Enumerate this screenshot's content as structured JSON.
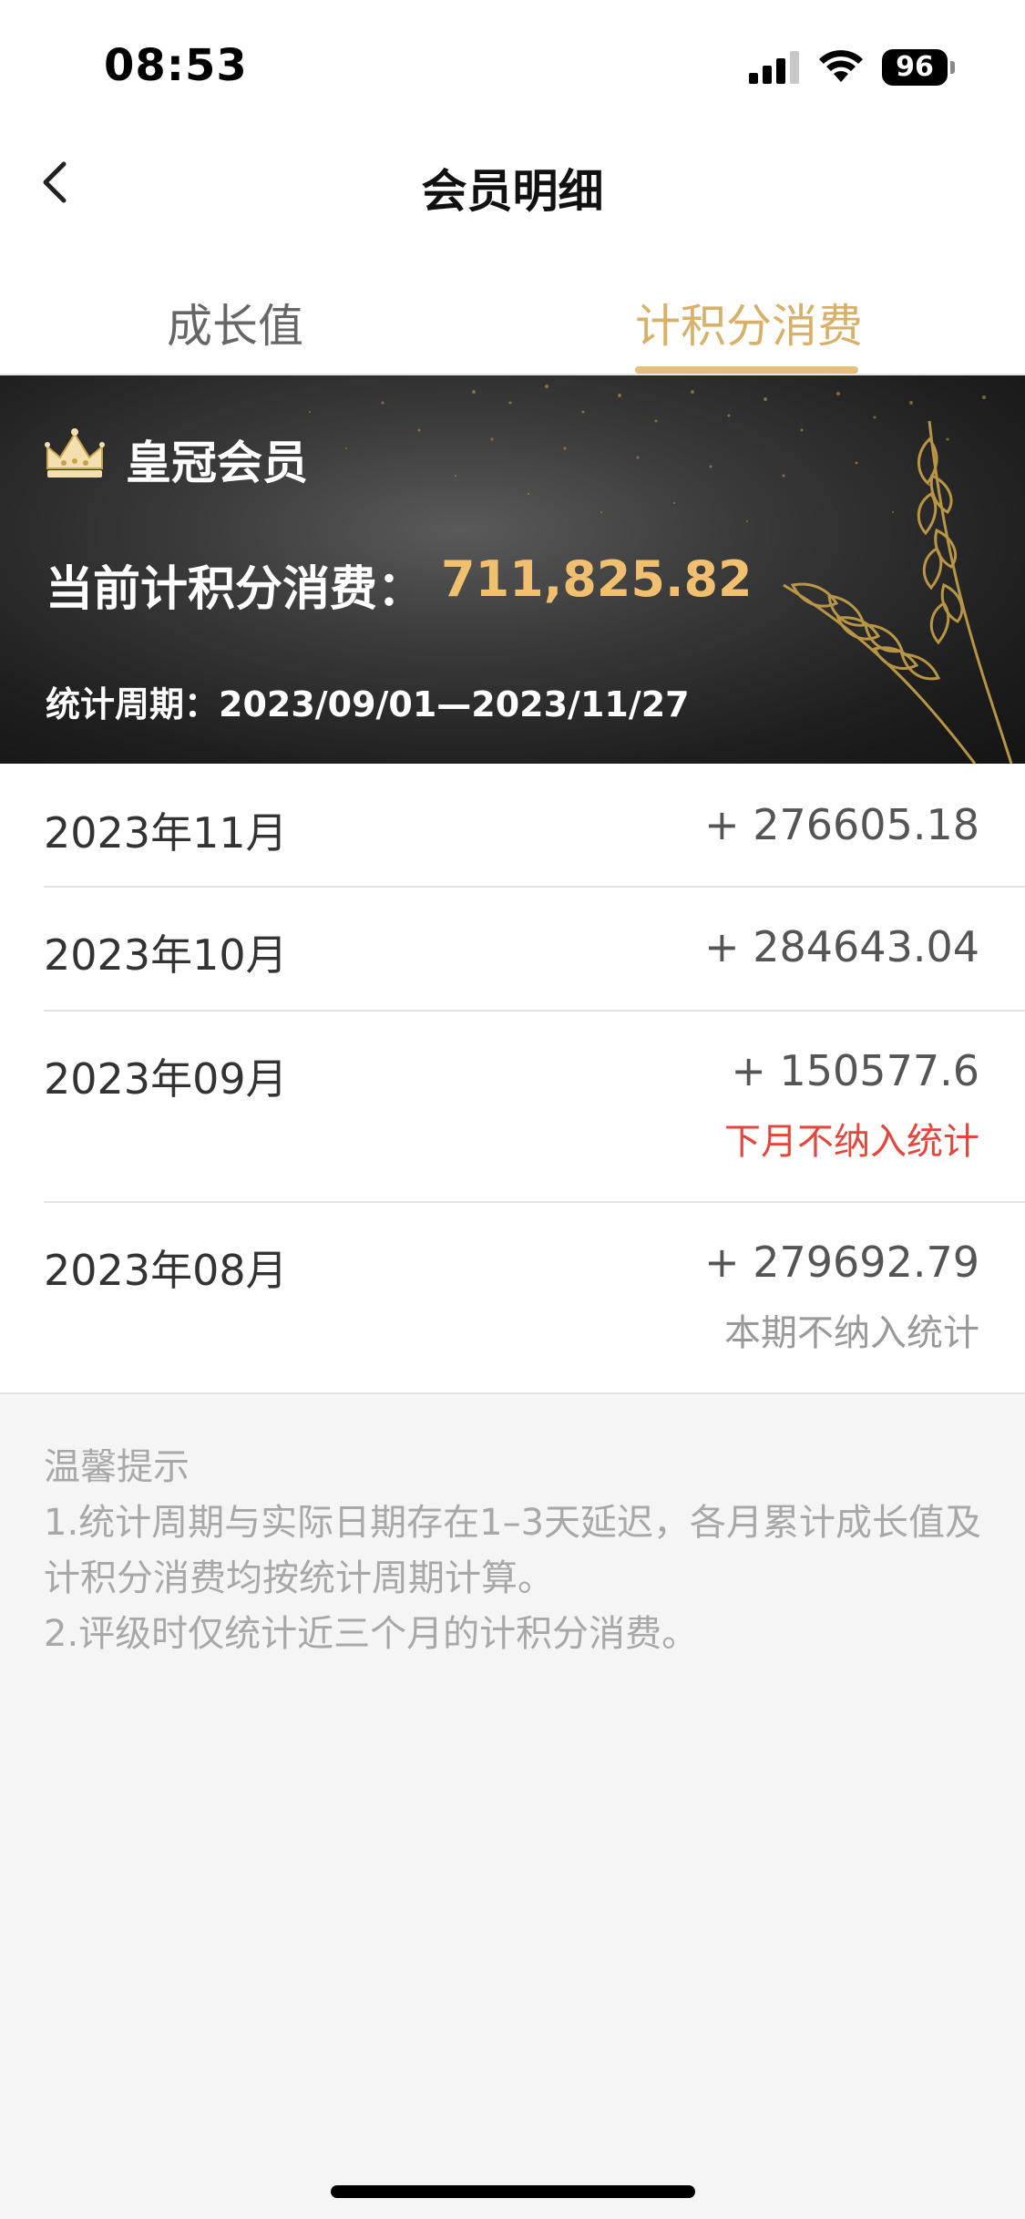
{
  "status": {
    "time": "08:53",
    "battery": "96"
  },
  "nav": {
    "title": "会员明细"
  },
  "tabs": [
    {
      "label": "成长值",
      "active": false
    },
    {
      "label": "计积分消费",
      "active": true
    }
  ],
  "banner": {
    "tier": "皇冠会员",
    "current_label": "当前计积分消费：",
    "current_value": "711,825.82",
    "period_label": "统计周期：",
    "period_value": "2023/09/01—2023/11/27"
  },
  "records": [
    {
      "month": "2023年11月",
      "amount": "+ 276605.18",
      "note": ""
    },
    {
      "month": "2023年10月",
      "amount": "+ 284643.04",
      "note": ""
    },
    {
      "month": "2023年09月",
      "amount": "+ 150577.6",
      "note": "下月不纳入统计"
    },
    {
      "month": "2023年08月",
      "amount": "+ 279692.79",
      "note": "本期不纳入统计"
    }
  ],
  "tips": {
    "title": "温馨提示",
    "line1": "1.统计周期与实际日期存在1–3天延迟，各月累计成长值及计积分消费均按统计周期计算。",
    "line2": "2.评级时仅统计近三个月的计积分消费。"
  },
  "colors": {
    "accent_gold": "#e5c07b",
    "value_gold": "#f0c070",
    "note_red": "#e6453c"
  },
  "icons": [
    "back-icon",
    "crown-icon",
    "wheat-icon",
    "signal-icon",
    "wifi-icon",
    "battery-icon"
  ]
}
